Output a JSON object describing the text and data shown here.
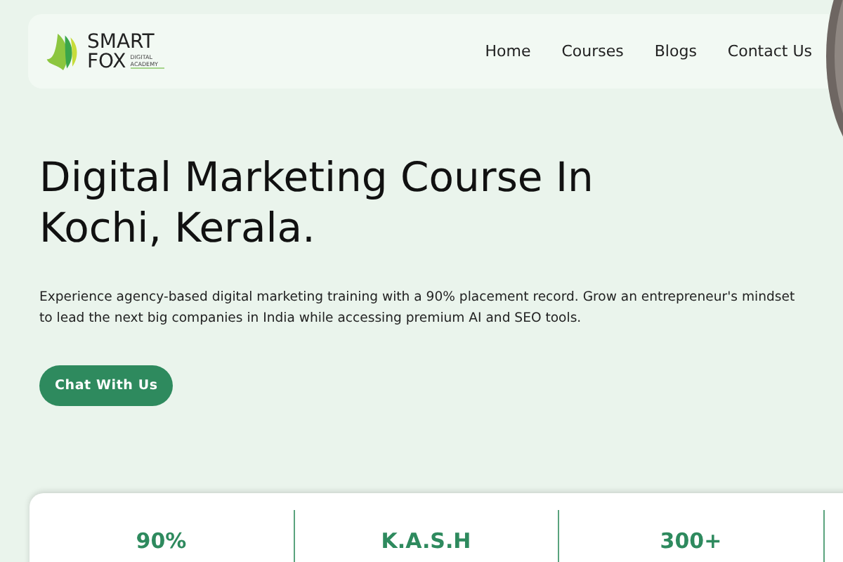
{
  "logo": {
    "name_lines": [
      "SMART",
      "FOX"
    ],
    "tagline": "DIGITAL ACADEMY"
  },
  "nav": [
    "Home",
    "Courses",
    "Blogs",
    "Contact Us"
  ],
  "hero": {
    "title": "Digital Marketing Course In Kochi, Kerala.",
    "description": "Experience agency-based digital marketing training with a 90% placement record. Grow an entrepreneur's mindset to lead the next big companies in India while accessing premium AI and SEO tools.",
    "button": "Chat With Us"
  },
  "stats": [
    "90%",
    "K.A.S.H",
    "300+"
  ]
}
